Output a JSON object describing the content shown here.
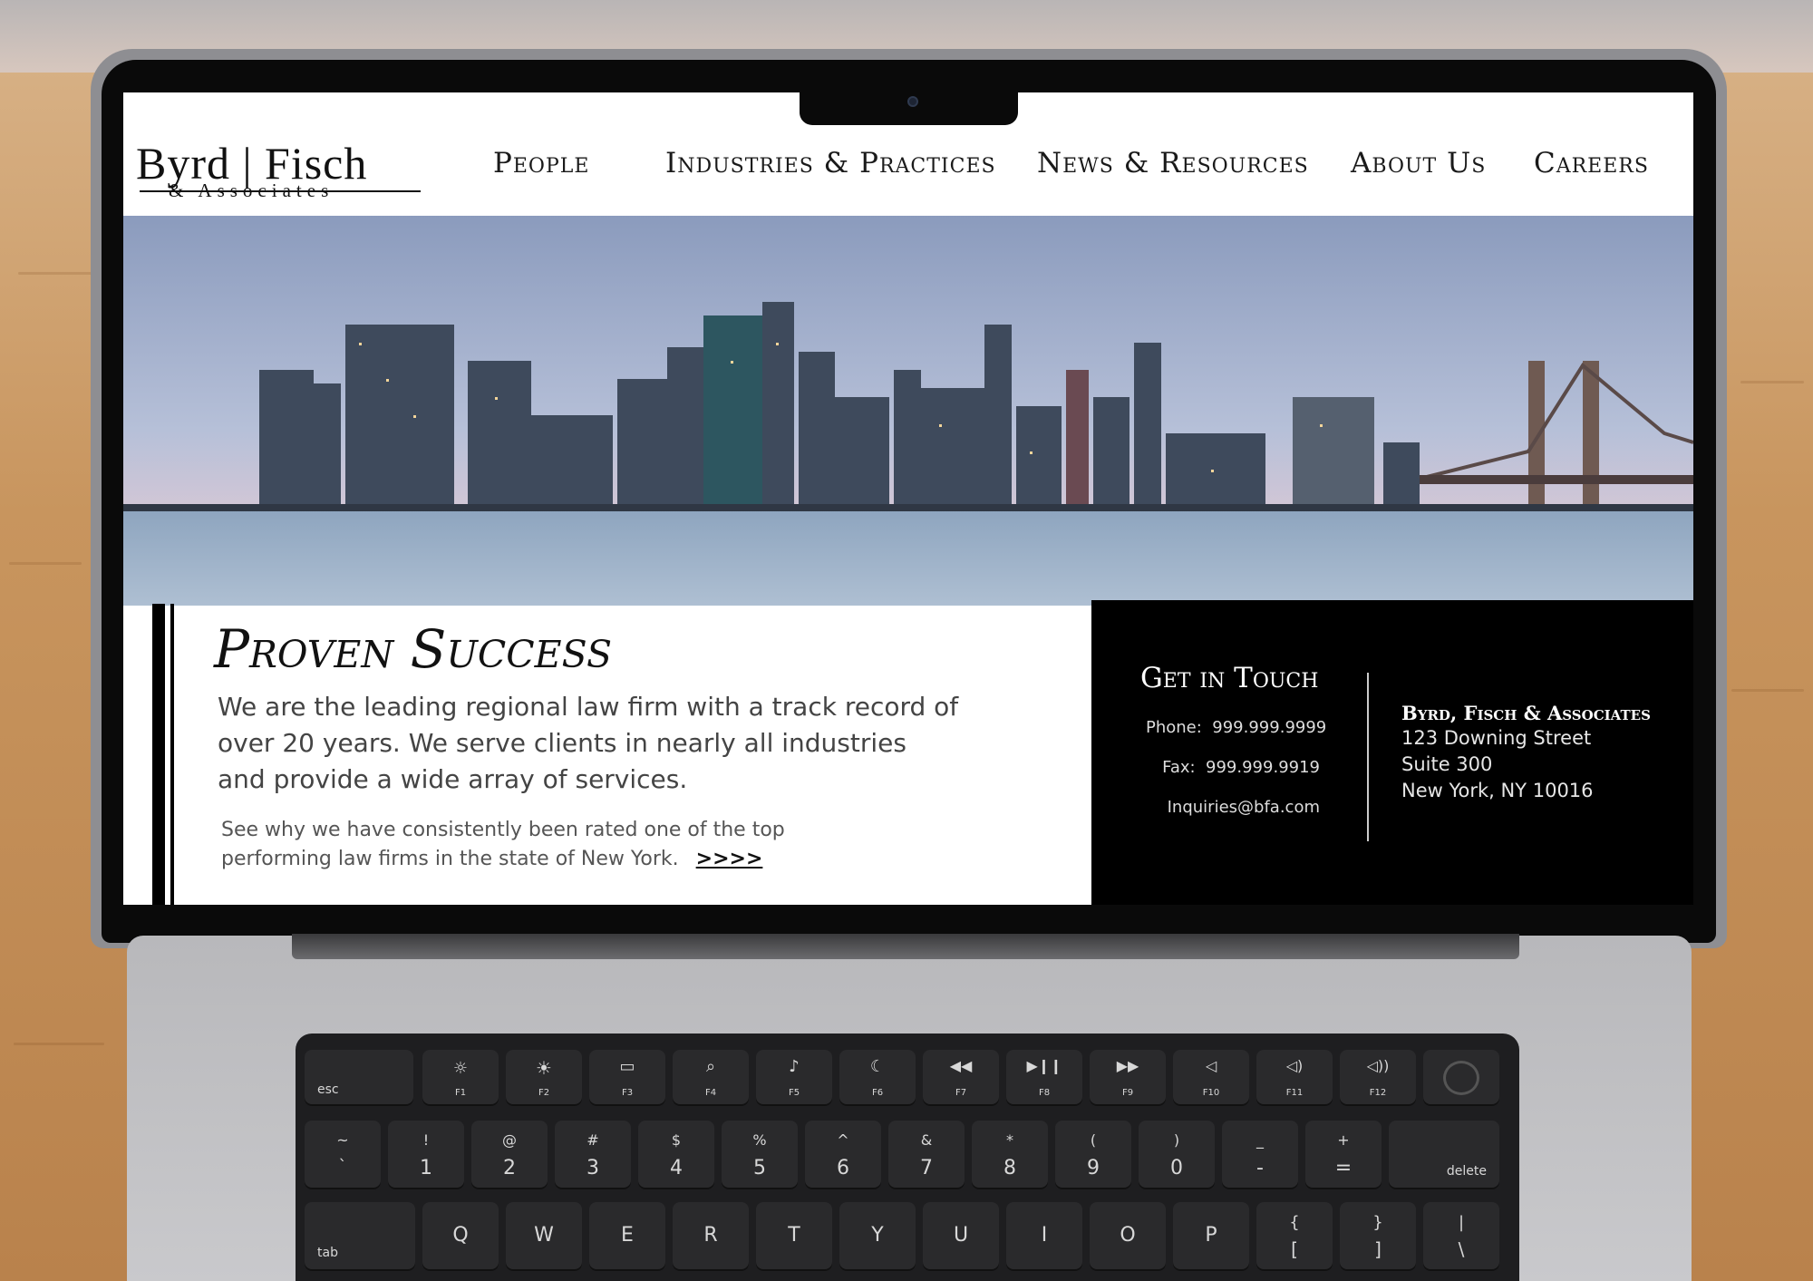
{
  "website": {
    "logo": {
      "main": "Byrd | Fisch",
      "sub": "& Associates"
    },
    "nav": [
      {
        "label": "People"
      },
      {
        "label": "Industries & Practices"
      },
      {
        "label": "News & Resources"
      },
      {
        "label": "About Us"
      },
      {
        "label": "Careers"
      }
    ],
    "headline": "Proven Success",
    "body": "We are the leading regional law firm with a track record of over 20 years. We serve clients in nearly all industries and provide a wide array of services.",
    "sub_text": "See why we have consistently been rated one of the top performing law firms in the state of New York.",
    "sub_link": ">>>>",
    "contact": {
      "title": "Get in Touch",
      "phone_label": "Phone:",
      "phone": "999.999.9999",
      "fax_label": "Fax:",
      "fax": "999.999.9919",
      "email": "Inquiries@bfa.com"
    },
    "address": {
      "name": "Byrd, Fisch & Associates",
      "line1": "123 Downing Street",
      "line2": "Suite 300",
      "line3": "New York, NY 10016"
    }
  },
  "keyboard": {
    "fn_row": [
      "esc",
      "F1",
      "F2",
      "F3",
      "F4",
      "F5",
      "F6",
      "F7",
      "F8",
      "F9",
      "F10",
      "F11",
      "F12"
    ],
    "number_row": [
      {
        "top": "~",
        "bottom": "`"
      },
      {
        "top": "!",
        "bottom": "1"
      },
      {
        "top": "@",
        "bottom": "2"
      },
      {
        "top": "#",
        "bottom": "3"
      },
      {
        "top": "$",
        "bottom": "4"
      },
      {
        "top": "%",
        "bottom": "5"
      },
      {
        "top": "^",
        "bottom": "6"
      },
      {
        "top": "&",
        "bottom": "7"
      },
      {
        "top": "*",
        "bottom": "8"
      },
      {
        "top": "(",
        "bottom": "9"
      },
      {
        "top": ")",
        "bottom": "0"
      },
      {
        "top": "_",
        "bottom": "-"
      },
      {
        "top": "+",
        "bottom": "="
      }
    ],
    "delete": "delete",
    "tab": "tab",
    "qwerty_row": [
      "Q",
      "W",
      "E",
      "R",
      "T",
      "Y",
      "U",
      "I",
      "O",
      "P"
    ],
    "bracket_keys": [
      {
        "top": "{",
        "bottom": "["
      },
      {
        "top": "}",
        "bottom": "]"
      },
      {
        "top": "|",
        "bottom": "\\"
      }
    ]
  }
}
